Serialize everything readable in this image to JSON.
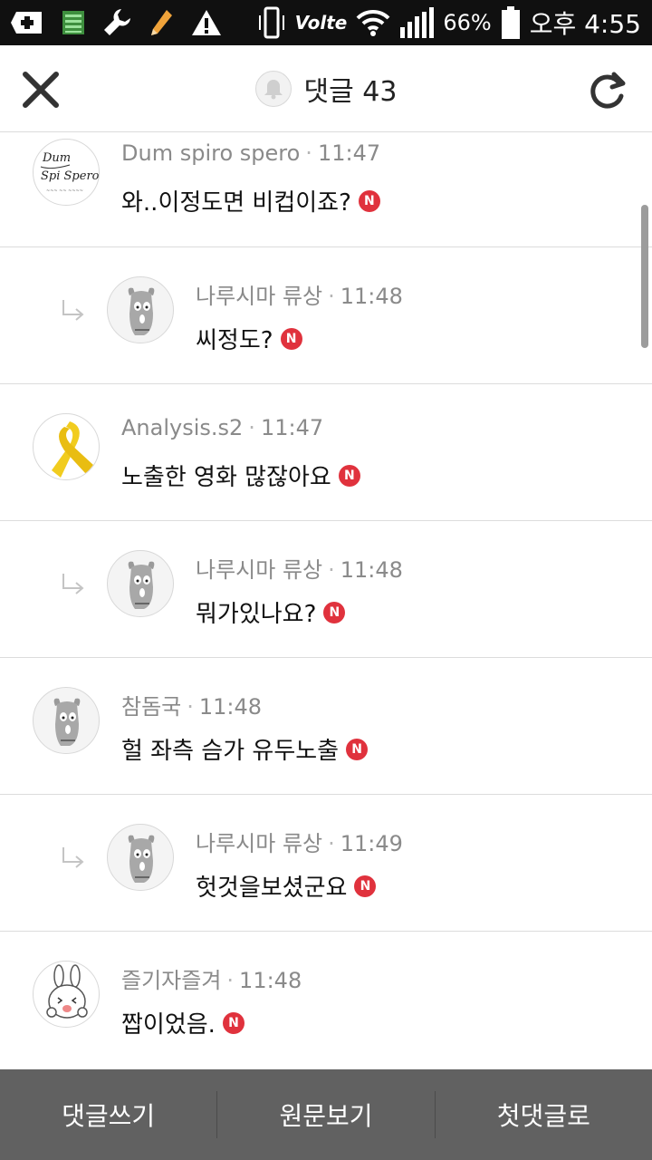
{
  "status_bar": {
    "volte_label": "Volte",
    "battery_percent": "66%",
    "time": "오후 4:55",
    "icons": [
      "add-box-icon",
      "storage-icon",
      "wrench-icon",
      "pencil-icon",
      "warning-icon",
      "vibrate-icon",
      "volte-icon",
      "wifi-icon",
      "signal-icon",
      "battery-icon"
    ]
  },
  "header": {
    "title": "댓글 43",
    "close_icon": "close-icon",
    "bell_icon": "bell-icon",
    "refresh_icon": "refresh-icon"
  },
  "comments": [
    {
      "author": "Dum spiro spero",
      "time": "11:47",
      "text": "와..이정도면 비컵이죠?",
      "badge": "N",
      "reply": false,
      "avatar": "dum-spiro-spero-avatar"
    },
    {
      "author": "나루시마 류상",
      "time": "11:48",
      "text": "씨정도?",
      "badge": "N",
      "reply": true,
      "avatar": "dog-avatar"
    },
    {
      "author": "Analysis.s2",
      "time": "11:47",
      "text": "노출한 영화 많잖아요",
      "badge": "N",
      "reply": false,
      "avatar": "yellow-ribbon-avatar"
    },
    {
      "author": "나루시마 류상",
      "time": "11:48",
      "text": "뭐가있나요?",
      "badge": "N",
      "reply": true,
      "avatar": "dog-avatar"
    },
    {
      "author": "참돔국",
      "time": "11:48",
      "text": "헐 좌측 슴가 유두노출",
      "badge": "N",
      "reply": false,
      "avatar": "dog-avatar"
    },
    {
      "author": "나루시마 류상",
      "time": "11:49",
      "text": "헛것을보셨군요",
      "badge": "N",
      "reply": true,
      "avatar": "dog-avatar"
    },
    {
      "author": "즐기자즐겨",
      "time": "11:48",
      "text": "짭이었음.",
      "badge": "N",
      "reply": false,
      "avatar": "rabbit-avatar"
    }
  ],
  "bottom_bar": {
    "write_comment": "댓글쓰기",
    "view_original": "원문보기",
    "to_first_comment": "첫댓글로"
  },
  "colors": {
    "status_bar_bg": "#101010",
    "badge_red": "#e0323d",
    "bottom_bar_bg": "#616161",
    "meta_gray": "#8a8a8a"
  }
}
